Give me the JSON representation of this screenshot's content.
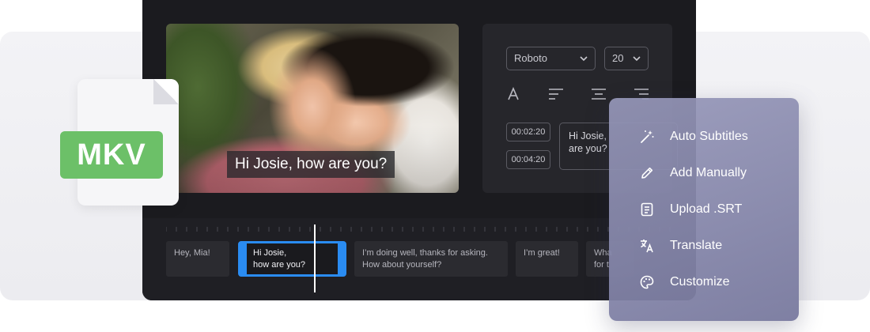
{
  "video": {
    "caption": "Hi Josie, how are you?"
  },
  "style_panel": {
    "font": "Roboto",
    "size": "20",
    "timestamps": [
      "00:02:20",
      "00:04:20"
    ],
    "subtitle_text": "Hi Josie,\nare you?"
  },
  "timeline": {
    "clips": [
      "Hey, Mia!",
      "Hi Josie,\nhow are you?",
      "I’m doing well, thanks for asking.\nHow about yourself?",
      "I’m great!",
      "Wha\nfor t"
    ]
  },
  "file_badge": {
    "label": "MKV"
  },
  "menu": {
    "items": [
      {
        "label": "Auto Subtitles",
        "icon": "magic-wand-icon"
      },
      {
        "label": "Add Manually",
        "icon": "pencil-icon"
      },
      {
        "label": "Upload .SRT",
        "icon": "document-icon"
      },
      {
        "label": "Translate",
        "icon": "translate-icon"
      },
      {
        "label": "Customize",
        "icon": "palette-icon"
      }
    ]
  },
  "colors": {
    "accent": "#2a8cf2",
    "badge": "#6cc068",
    "menu": "#8e8fb0"
  }
}
